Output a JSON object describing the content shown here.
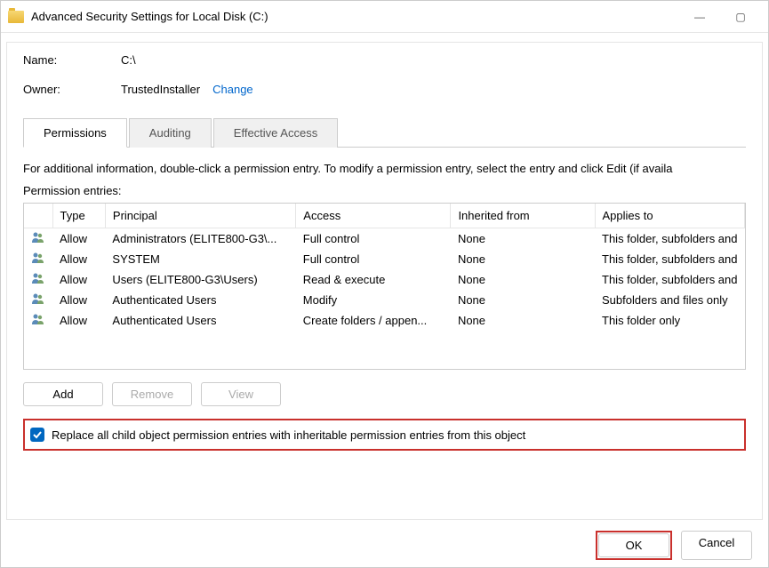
{
  "window": {
    "title": "Advanced Security Settings for Local Disk (C:)"
  },
  "fields": {
    "name_label": "Name:",
    "name_value": "C:\\",
    "owner_label": "Owner:",
    "owner_value": "TrustedInstaller",
    "change_link": "Change"
  },
  "tabs": {
    "permissions": "Permissions",
    "auditing": "Auditing",
    "effective_access": "Effective Access"
  },
  "help_text": "For additional information, double-click a permission entry. To modify a permission entry, select the entry and click Edit (if availa",
  "entries_label": "Permission entries:",
  "columns": {
    "type": "Type",
    "principal": "Principal",
    "access": "Access",
    "inherited": "Inherited from",
    "applies": "Applies to"
  },
  "entries": [
    {
      "type": "Allow",
      "principal": "Administrators (ELITE800-G3\\...",
      "access": "Full control",
      "inherited": "None",
      "applies": "This folder, subfolders and"
    },
    {
      "type": "Allow",
      "principal": "SYSTEM",
      "access": "Full control",
      "inherited": "None",
      "applies": "This folder, subfolders and"
    },
    {
      "type": "Allow",
      "principal": "Users (ELITE800-G3\\Users)",
      "access": "Read & execute",
      "inherited": "None",
      "applies": "This folder, subfolders and"
    },
    {
      "type": "Allow",
      "principal": "Authenticated Users",
      "access": "Modify",
      "inherited": "None",
      "applies": "Subfolders and files only"
    },
    {
      "type": "Allow",
      "principal": "Authenticated Users",
      "access": "Create folders / appen...",
      "inherited": "None",
      "applies": "This folder only"
    }
  ],
  "buttons": {
    "add": "Add",
    "remove": "Remove",
    "view": "View",
    "ok": "OK",
    "cancel": "Cancel"
  },
  "checkbox_label": "Replace all child object permission entries with inheritable permission entries from this object"
}
